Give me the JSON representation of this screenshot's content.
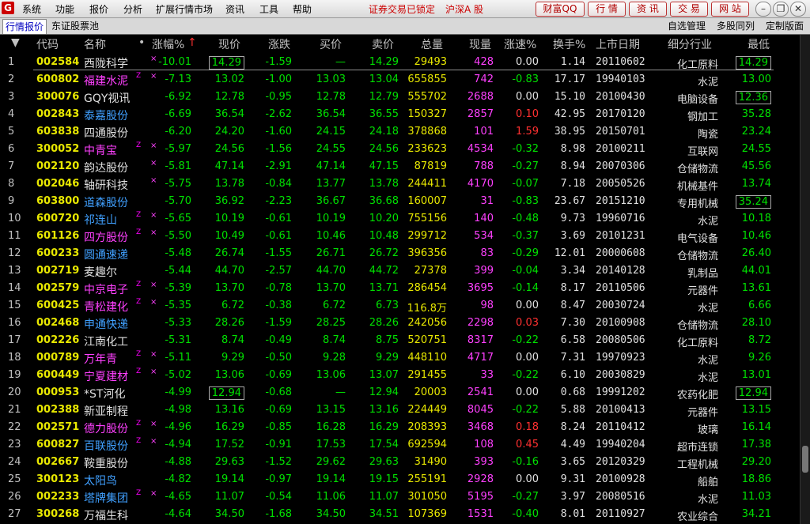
{
  "menubar": {
    "items": [
      "系统",
      "功能",
      "报价",
      "分析",
      "扩展行情市场",
      "资讯",
      "工具",
      "帮助"
    ],
    "status1": "证券交易已锁定",
    "status2": "沪深A 股",
    "buttons": [
      "财富QQ",
      "行 情",
      "资 讯",
      "交 易",
      "网 站"
    ]
  },
  "tabs": {
    "active": "行情报价",
    "second": "东证股票池",
    "right": [
      "自选管理",
      "多股同列",
      "定制版面"
    ]
  },
  "headers": [
    "代码",
    "名称",
    "涨幅%",
    "现价",
    "涨跌",
    "买价",
    "卖价",
    "总量",
    "现量",
    "涨速%",
    "换手%",
    "上市日期",
    "细分行业",
    "最低"
  ],
  "header_extra": {
    "sort_glyph": "▼",
    "dot": "•",
    "sort_arrow": "↑"
  },
  "rows": [
    [
      "1",
      "002584",
      "西陇科学",
      "",
      "-10.01",
      "14.29",
      "-1.59",
      "—",
      "14.29",
      "29493",
      "428",
      "0.00",
      "1.14",
      "20110602",
      "化工原料",
      "14.29"
    ],
    [
      "2",
      "600802",
      "福建水泥",
      "Z",
      "-7.13",
      "13.02",
      "-1.00",
      "13.03",
      "13.04",
      "655855",
      "742",
      "-0.83",
      "17.17",
      "19940103",
      "水泥",
      "13.00"
    ],
    [
      "3",
      "300076",
      "GQY视讯",
      "",
      "-6.92",
      "12.78",
      "-0.95",
      "12.78",
      "12.79",
      "555702",
      "2688",
      "0.00",
      "15.10",
      "20100430",
      "电脑设备",
      "12.36"
    ],
    [
      "4",
      "002843",
      "泰嘉股份",
      "",
      "-6.69",
      "36.54",
      "-2.62",
      "36.54",
      "36.55",
      "150327",
      "2857",
      "0.10",
      "42.95",
      "20170120",
      "钢加工",
      "35.28"
    ],
    [
      "5",
      "603838",
      "四通股份",
      "",
      "-6.20",
      "24.20",
      "-1.60",
      "24.15",
      "24.18",
      "378868",
      "101",
      "1.59",
      "38.95",
      "20150701",
      "陶瓷",
      "23.24"
    ],
    [
      "6",
      "300052",
      "中青宝",
      "Z",
      "-5.97",
      "24.56",
      "-1.56",
      "24.55",
      "24.56",
      "233623",
      "4534",
      "-0.32",
      "8.98",
      "20100211",
      "互联网",
      "24.55"
    ],
    [
      "7",
      "002120",
      "韵达股份",
      "",
      "-5.81",
      "47.14",
      "-2.91",
      "47.14",
      "47.15",
      "87819",
      "788",
      "-0.27",
      "8.94",
      "20070306",
      "仓储物流",
      "45.56"
    ],
    [
      "8",
      "002046",
      "轴研科技",
      "",
      "-5.75",
      "13.78",
      "-0.84",
      "13.77",
      "13.78",
      "244411",
      "4170",
      "-0.07",
      "7.18",
      "20050526",
      "机械基件",
      "13.74"
    ],
    [
      "9",
      "603800",
      "道森股份",
      "",
      "-5.70",
      "36.92",
      "-2.23",
      "36.67",
      "36.68",
      "160007",
      "31",
      "-0.83",
      "23.67",
      "20151210",
      "专用机械",
      "35.24"
    ],
    [
      "10",
      "600720",
      "祁连山",
      "Z",
      "-5.65",
      "10.19",
      "-0.61",
      "10.19",
      "10.20",
      "755156",
      "140",
      "-0.48",
      "9.73",
      "19960716",
      "水泥",
      "10.18"
    ],
    [
      "11",
      "601126",
      "四方股份",
      "Z",
      "-5.50",
      "10.49",
      "-0.61",
      "10.46",
      "10.48",
      "299712",
      "534",
      "-0.37",
      "3.69",
      "20101231",
      "电气设备",
      "10.46"
    ],
    [
      "12",
      "600233",
      "圆通速递",
      "",
      "-5.48",
      "26.74",
      "-1.55",
      "26.71",
      "26.72",
      "396356",
      "83",
      "-0.29",
      "12.01",
      "20000608",
      "仓储物流",
      "26.40"
    ],
    [
      "13",
      "002719",
      "麦趣尔",
      "",
      "-5.44",
      "44.70",
      "-2.57",
      "44.70",
      "44.72",
      "27378",
      "399",
      "-0.04",
      "3.34",
      "20140128",
      "乳制品",
      "44.01"
    ],
    [
      "14",
      "002579",
      "中京电子",
      "Z",
      "-5.39",
      "13.70",
      "-0.78",
      "13.70",
      "13.71",
      "286454",
      "3695",
      "-0.14",
      "8.17",
      "20110506",
      "元器件",
      "13.61"
    ],
    [
      "15",
      "600425",
      "青松建化",
      "Z",
      "-5.35",
      "6.72",
      "-0.38",
      "6.72",
      "6.73",
      "116.8万",
      "98",
      "0.00",
      "8.47",
      "20030724",
      "水泥",
      "6.66"
    ],
    [
      "16",
      "002468",
      "申通快递",
      "",
      "-5.33",
      "28.26",
      "-1.59",
      "28.25",
      "28.26",
      "242056",
      "2298",
      "0.03",
      "7.30",
      "20100908",
      "仓储物流",
      "28.10"
    ],
    [
      "17",
      "002226",
      "江南化工",
      "",
      "-5.31",
      "8.74",
      "-0.49",
      "8.74",
      "8.75",
      "520751",
      "8317",
      "-0.22",
      "6.58",
      "20080506",
      "化工原料",
      "8.72"
    ],
    [
      "18",
      "000789",
      "万年青",
      "Z",
      "-5.11",
      "9.29",
      "-0.50",
      "9.28",
      "9.29",
      "448110",
      "4717",
      "0.00",
      "7.31",
      "19970923",
      "水泥",
      "9.26"
    ],
    [
      "19",
      "600449",
      "宁夏建材",
      "Z",
      "-5.02",
      "13.06",
      "-0.69",
      "13.06",
      "13.07",
      "291455",
      "33",
      "-0.22",
      "6.10",
      "20030829",
      "水泥",
      "13.01"
    ],
    [
      "20",
      "000953",
      "*ST河化",
      "",
      "-4.99",
      "12.94",
      "-0.68",
      "—",
      "12.94",
      "20003",
      "2541",
      "0.00",
      "0.68",
      "19991202",
      "农药化肥",
      "12.94"
    ],
    [
      "21",
      "002388",
      "新亚制程",
      "",
      "-4.98",
      "13.16",
      "-0.69",
      "13.15",
      "13.16",
      "224449",
      "8045",
      "-0.22",
      "5.88",
      "20100413",
      "元器件",
      "13.15"
    ],
    [
      "22",
      "002571",
      "德力股份",
      "Z",
      "-4.96",
      "16.29",
      "-0.85",
      "16.28",
      "16.29",
      "208393",
      "3468",
      "0.18",
      "8.24",
      "20110412",
      "玻璃",
      "16.14"
    ],
    [
      "23",
      "600827",
      "百联股份",
      "Z",
      "-4.94",
      "17.52",
      "-0.91",
      "17.53",
      "17.54",
      "692594",
      "108",
      "0.45",
      "4.49",
      "19940204",
      "超市连锁",
      "17.38"
    ],
    [
      "24",
      "002667",
      "鞍重股份",
      "",
      "-4.88",
      "29.63",
      "-1.52",
      "29.62",
      "29.63",
      "31490",
      "393",
      "-0.16",
      "3.65",
      "20120329",
      "工程机械",
      "29.20"
    ],
    [
      "25",
      "300123",
      "太阳鸟",
      "",
      "-4.82",
      "19.14",
      "-0.97",
      "19.14",
      "19.15",
      "255191",
      "2928",
      "0.00",
      "9.31",
      "20100928",
      "船舶",
      "18.86"
    ],
    [
      "26",
      "002233",
      "塔牌集团",
      "Z",
      "-4.65",
      "11.07",
      "-0.54",
      "11.06",
      "11.07",
      "301050",
      "5195",
      "-0.27",
      "3.97",
      "20080516",
      "水泥",
      "11.03"
    ],
    [
      "27",
      "300268",
      "万福生科",
      "",
      "-4.64",
      "34.50",
      "-1.68",
      "34.50",
      "34.51",
      "107369",
      "1531",
      "-0.40",
      "8.01",
      "20110927",
      "农业综合",
      "34.21"
    ]
  ],
  "name_colors": {
    "2": "#ff40ff",
    "4": "#40a0ff",
    "6": "#ff40ff",
    "9": "#40a0ff",
    "10": "#40a0ff",
    "11": "#ff40ff",
    "12": "#40a0ff",
    "14": "#ff40ff",
    "15": "#ff40ff",
    "16": "#40a0ff",
    "18": "#ff40ff",
    "19": "#ff40ff",
    "22": "#ff40ff",
    "23": "#40a0ff",
    "25": "#40a0ff",
    "26": "#40a0ff"
  },
  "star_rows": [
    "1",
    "2",
    "6",
    "7",
    "8",
    "10",
    "11",
    "14",
    "15",
    "18",
    "19",
    "22",
    "23",
    "26"
  ],
  "boxed_price_rows": [
    "1",
    "20"
  ],
  "boxed_low_rows": [
    "1",
    "3",
    "9",
    "20"
  ],
  "colors": {
    "down": "#00e000",
    "up": "#ff3030",
    "neutral": "#e0e0e0",
    "qty": "#ff40ff",
    "total": "#e8e800",
    "white": "#e0e0e0"
  }
}
